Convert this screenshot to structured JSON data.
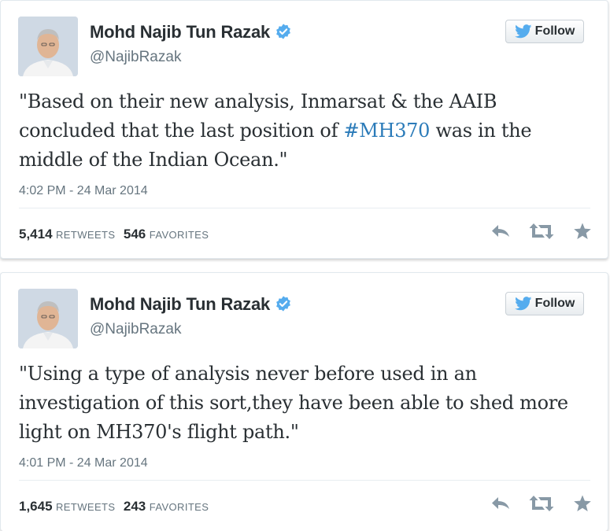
{
  "tweets": [
    {
      "display_name": "Mohd Najib Tun Razak",
      "handle": "@NajibRazak",
      "follow_label": "Follow",
      "text_before": "\"Based on their new analysis, Inmarsat & the AAIB concluded that the last position of ",
      "hashtag": "#MH370",
      "text_after": " was in the middle of the Indian Ocean.\"",
      "timestamp": "4:02 PM - 24 Mar 2014",
      "retweets": "5,414",
      "retweets_label": "RETWEETS",
      "favorites": "546",
      "favorites_label": "FAVORITES"
    },
    {
      "display_name": "Mohd Najib Tun Razak",
      "handle": "@NajibRazak",
      "follow_label": "Follow",
      "text": "\"Using a type of analysis never before used in an investigation of this sort,they have been able to shed more light on MH370's flight path.\"",
      "timestamp": "4:01 PM - 24 Mar 2014",
      "retweets": "1,645",
      "retweets_label": "RETWEETS",
      "favorites": "243",
      "favorites_label": "FAVORITES"
    }
  ],
  "icons": {
    "verified": "verified-badge-icon",
    "bird": "twitter-bird-icon",
    "reply": "reply-icon",
    "retweet": "retweet-icon",
    "favorite": "star-icon"
  },
  "colors": {
    "link": "#2b7bb9",
    "verified": "#55acee",
    "icon_gray": "#8899a6"
  }
}
